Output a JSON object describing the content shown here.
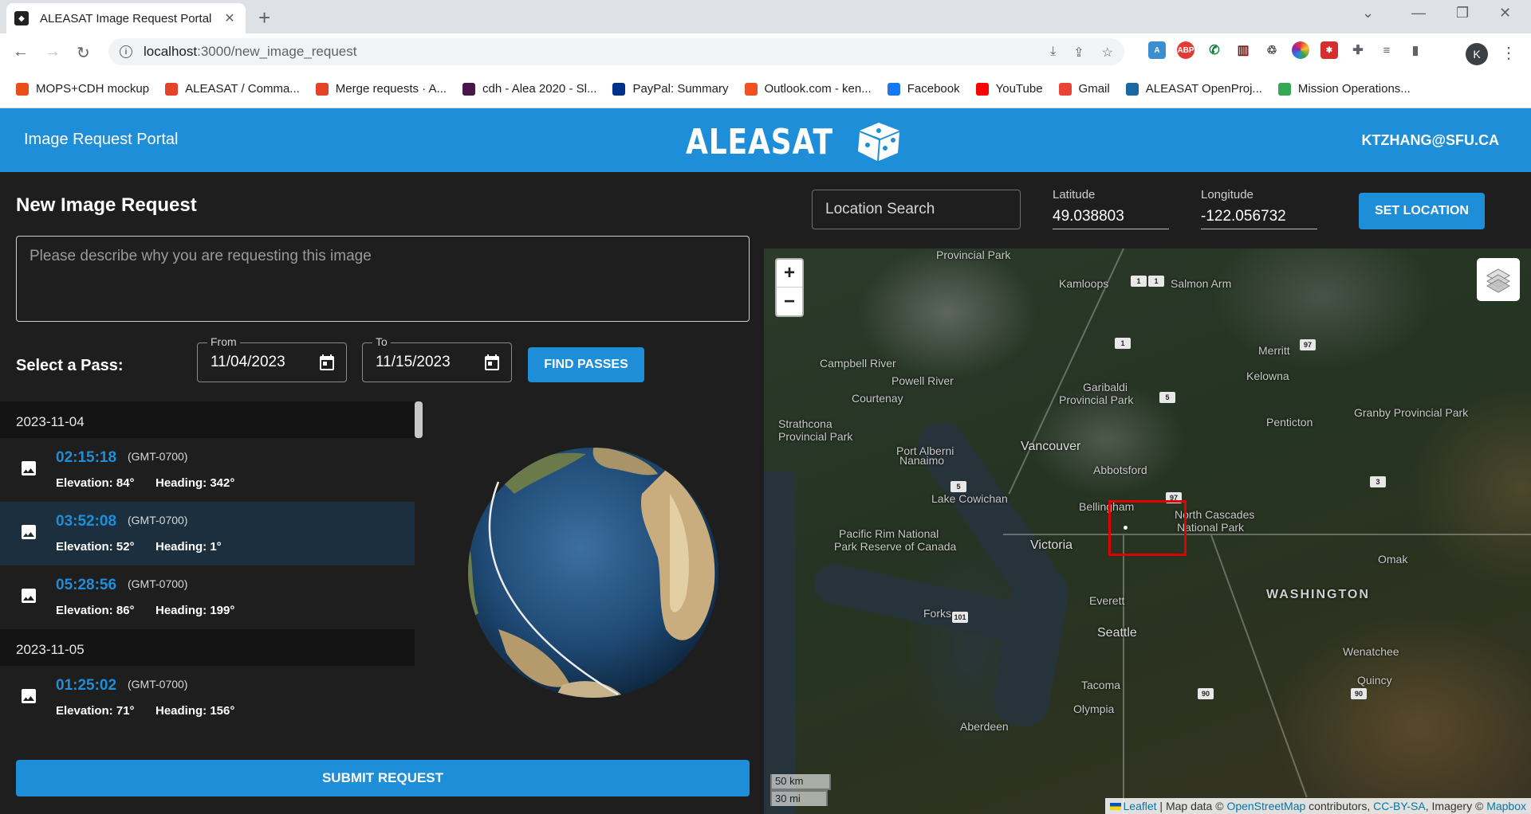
{
  "browser": {
    "tab_title": "ALEASAT Image Request Portal",
    "tab_close": "✕",
    "new_tab": "+",
    "url_host": "localhost",
    "url_path": ":3000/new_image_request",
    "profile_initial": "K",
    "bookmarks": [
      {
        "label": "MOPS+CDH mockup",
        "color": "#e94e1b"
      },
      {
        "label": "ALEASAT / Comma...",
        "color": "#e24329"
      },
      {
        "label": "Merge requests · A...",
        "color": "#e24329"
      },
      {
        "label": "cdh - Alea 2020 - Sl...",
        "color": "#4a154b"
      },
      {
        "label": "PayPal: Summary",
        "color": "#003087"
      },
      {
        "label": "Outlook.com - ken...",
        "color": "#f25022"
      },
      {
        "label": "Facebook",
        "color": "#1877f2"
      },
      {
        "label": "YouTube",
        "color": "#ff0000"
      },
      {
        "label": "Gmail",
        "color": "#ea4335"
      },
      {
        "label": "ALEASAT OpenProj...",
        "color": "#1a67a3"
      },
      {
        "label": "Mission Operations...",
        "color": "#34a853"
      }
    ]
  },
  "header": {
    "portal_title": "Image Request Portal",
    "logo_text": "ALEASAT",
    "user_email": "KTZHANG@SFU.CA",
    "brand_color": "#1f8ed8"
  },
  "request": {
    "title": "New Image Request",
    "description_placeholder": "Please describe why you are requesting this image",
    "select_pass_label": "Select a Pass:",
    "from_label": "From",
    "from_value": "11/04/2023",
    "to_label": "To",
    "to_value": "11/15/2023",
    "find_passes_label": "FIND PASSES",
    "submit_label": "SUBMIT REQUEST"
  },
  "passes": [
    {
      "date": "2023-11-04",
      "items": [
        {
          "time": "02:15:18",
          "tz": "(GMT-0700)",
          "elevation": "Elevation: 84°",
          "heading": "Heading: 342°",
          "selected": false
        },
        {
          "time": "03:52:08",
          "tz": "(GMT-0700)",
          "elevation": "Elevation: 52°",
          "heading": "Heading: 1°",
          "selected": true
        },
        {
          "time": "05:28:56",
          "tz": "(GMT-0700)",
          "elevation": "Elevation: 86°",
          "heading": "Heading: 199°",
          "selected": false
        }
      ]
    },
    {
      "date": "2023-11-05",
      "items": [
        {
          "time": "01:25:02",
          "tz": "(GMT-0700)",
          "elevation": "Elevation: 71°",
          "heading": "Heading: 156°",
          "selected": false
        }
      ]
    }
  ],
  "location": {
    "search_placeholder": "Location Search",
    "latitude_label": "Latitude",
    "latitude_value": "49.038803",
    "longitude_label": "Longitude",
    "longitude_value": "-122.056732",
    "set_location_label": "SET LOCATION"
  },
  "map": {
    "zoom_in": "+",
    "zoom_out": "−",
    "labels": [
      {
        "text": "Provincial Park",
        "kind": "normal"
      },
      {
        "text": "Kamloops",
        "kind": "normal"
      },
      {
        "text": "Salmon Arm",
        "kind": "normal"
      },
      {
        "text": "Campbell River",
        "kind": "normal"
      },
      {
        "text": "Powell River",
        "kind": "normal"
      },
      {
        "text": "Merritt",
        "kind": "normal"
      },
      {
        "text": "Kelowna",
        "kind": "normal"
      },
      {
        "text": "Courtenay",
        "kind": "normal"
      },
      {
        "text": "Garibaldi",
        "kind": "normal"
      },
      {
        "text": "Provincial Park",
        "kind": "normal"
      },
      {
        "text": "Strathcona",
        "kind": "normal"
      },
      {
        "text": "Provincial Park",
        "kind": "normal"
      },
      {
        "text": "Penticton",
        "kind": "normal"
      },
      {
        "text": "Granby Provincial Park",
        "kind": "normal"
      },
      {
        "text": "Port Alberni",
        "kind": "normal"
      },
      {
        "text": "Nanaimo",
        "kind": "normal"
      },
      {
        "text": "Vancouver",
        "kind": "city"
      },
      {
        "text": "Abbotsford",
        "kind": "normal"
      },
      {
        "text": "Lake Cowichan",
        "kind": "normal"
      },
      {
        "text": "Bellingham",
        "kind": "normal"
      },
      {
        "text": "North Cascades",
        "kind": "normal"
      },
      {
        "text": "National Park",
        "kind": "normal"
      },
      {
        "text": "Pacific Rim National",
        "kind": "normal"
      },
      {
        "text": "Park Reserve of Canada",
        "kind": "normal"
      },
      {
        "text": "Victoria",
        "kind": "city"
      },
      {
        "text": "Omak",
        "kind": "normal"
      },
      {
        "text": "WASHINGTON",
        "kind": "big"
      },
      {
        "text": "Everett",
        "kind": "normal"
      },
      {
        "text": "Forks",
        "kind": "normal"
      },
      {
        "text": "Seattle",
        "kind": "city"
      },
      {
        "text": "Wenatchee",
        "kind": "normal"
      },
      {
        "text": "Tacoma",
        "kind": "normal"
      },
      {
        "text": "Quincy",
        "kind": "normal"
      },
      {
        "text": "Olympia",
        "kind": "normal"
      },
      {
        "text": "Aberdeen",
        "kind": "normal"
      }
    ],
    "shields": [
      "1",
      "1",
      "1",
      "5",
      "97",
      "3",
      "97",
      "5",
      "101",
      "90",
      "90"
    ],
    "scale_km": "50 km",
    "scale_mi": "30 mi",
    "attribution": {
      "leaflet": "Leaflet",
      "sep1": " | Map data © ",
      "osm": "OpenStreetMap",
      "sep2": " contributors, ",
      "license": "CC-BY-SA",
      "sep3": ", Imagery © ",
      "imagery": "Mapbox"
    }
  }
}
